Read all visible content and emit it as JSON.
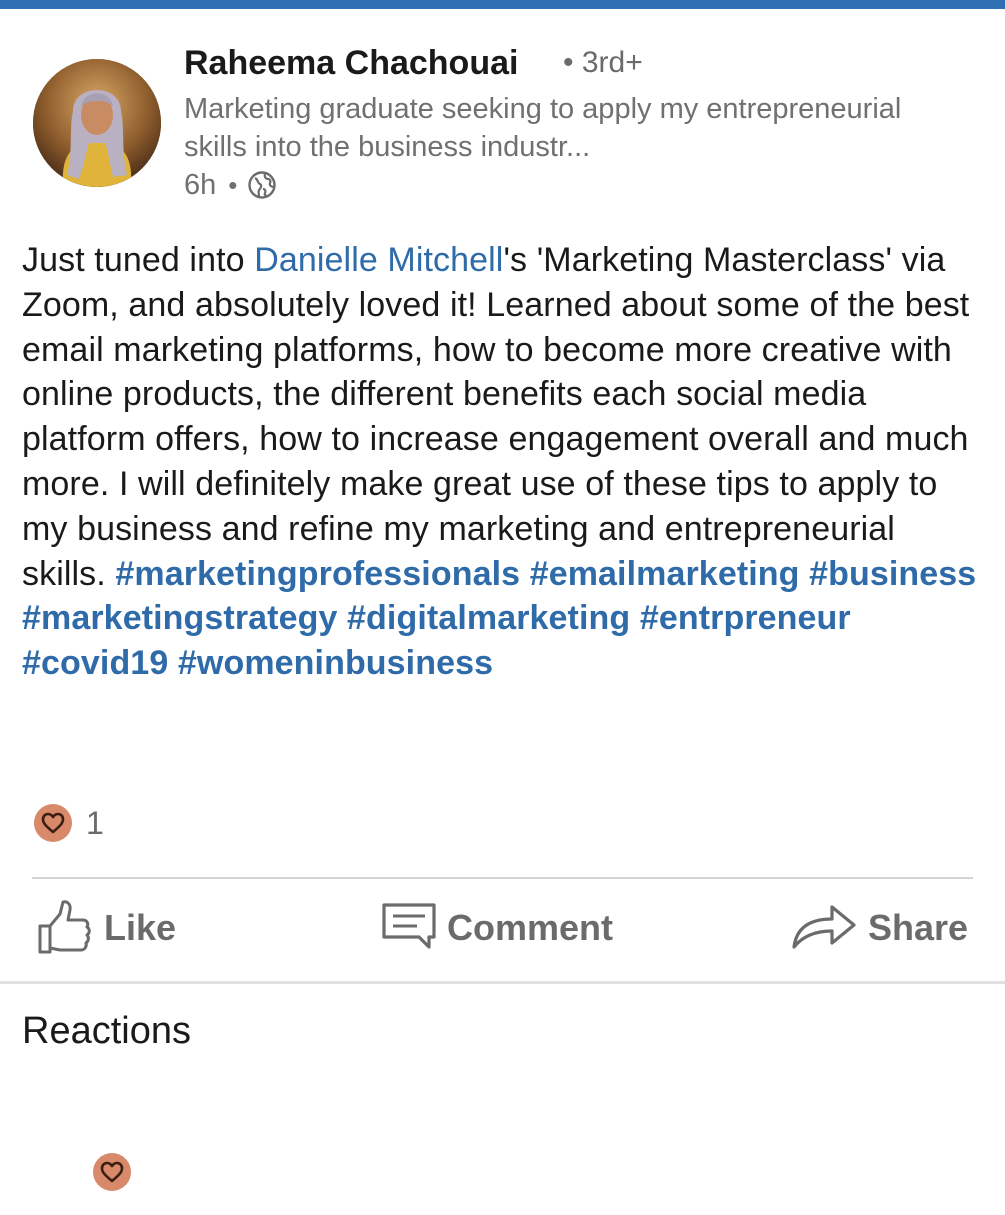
{
  "author": {
    "name": "Raheema Chachouai",
    "degree": "• 3rd+",
    "headline": "Marketing graduate seeking to apply my entrepreneurial skills into the business industr...",
    "time": "6h",
    "visibility_icon": "globe-icon"
  },
  "post": {
    "text_intro": "Just tuned into ",
    "mention": "Danielle Mitchell",
    "text_body": "'s 'Marketing Masterclass' via Zoom, and absolutely loved it! Learned about some of the  best email marketing platforms, how to become more creative with online products, the different benefits each social media platform offers, how to increase engagement overall and much more. I will definitely make great use of these tips to apply to my business and refine my marketing and entrepreneurial skills. ",
    "hashtags": [
      "#marketingprofessionals",
      "#emailmarketing",
      "#business",
      "#marketingstrategy",
      "#digitalmarketing",
      "#entrpreneur",
      "#covid19",
      "#womeninbusiness"
    ]
  },
  "reactions_summary": {
    "icon": "heart-icon",
    "count": "1"
  },
  "actions": {
    "like_label": "Like",
    "comment_label": "Comment",
    "share_label": "Share"
  },
  "reactions_section": {
    "title": "Reactions",
    "icon": "heart-icon"
  },
  "colors": {
    "accent": "#2f6fb3",
    "link": "#2e6ba8",
    "heart_badge": "#d7896a",
    "muted_text": "#6b6b6b"
  }
}
